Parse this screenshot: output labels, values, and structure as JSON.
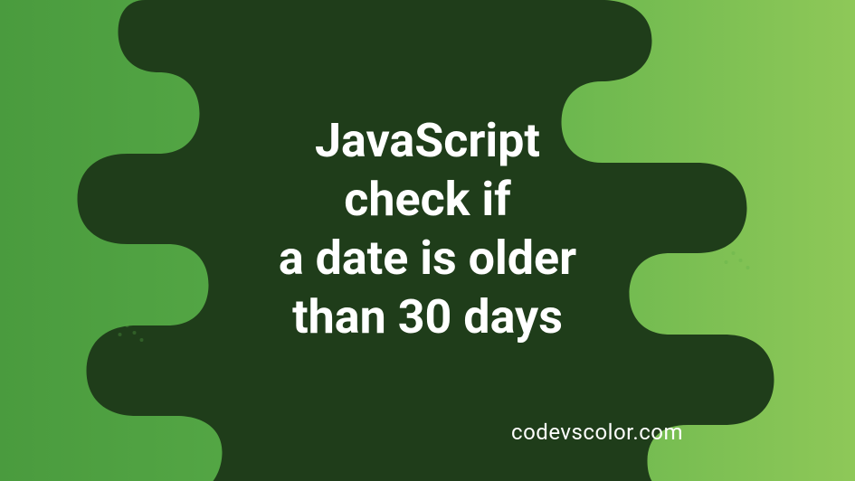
{
  "banner": {
    "title_line1": "JavaScript",
    "title_line2": "check if",
    "title_line3": "a date is older",
    "title_line4": "than 30 days",
    "watermark": "codevscolor.com"
  },
  "colors": {
    "gradient_start": "#4a9b3e",
    "gradient_end": "#8ec858",
    "blob_fill": "#1f3d1a",
    "text": "#ffffff"
  }
}
